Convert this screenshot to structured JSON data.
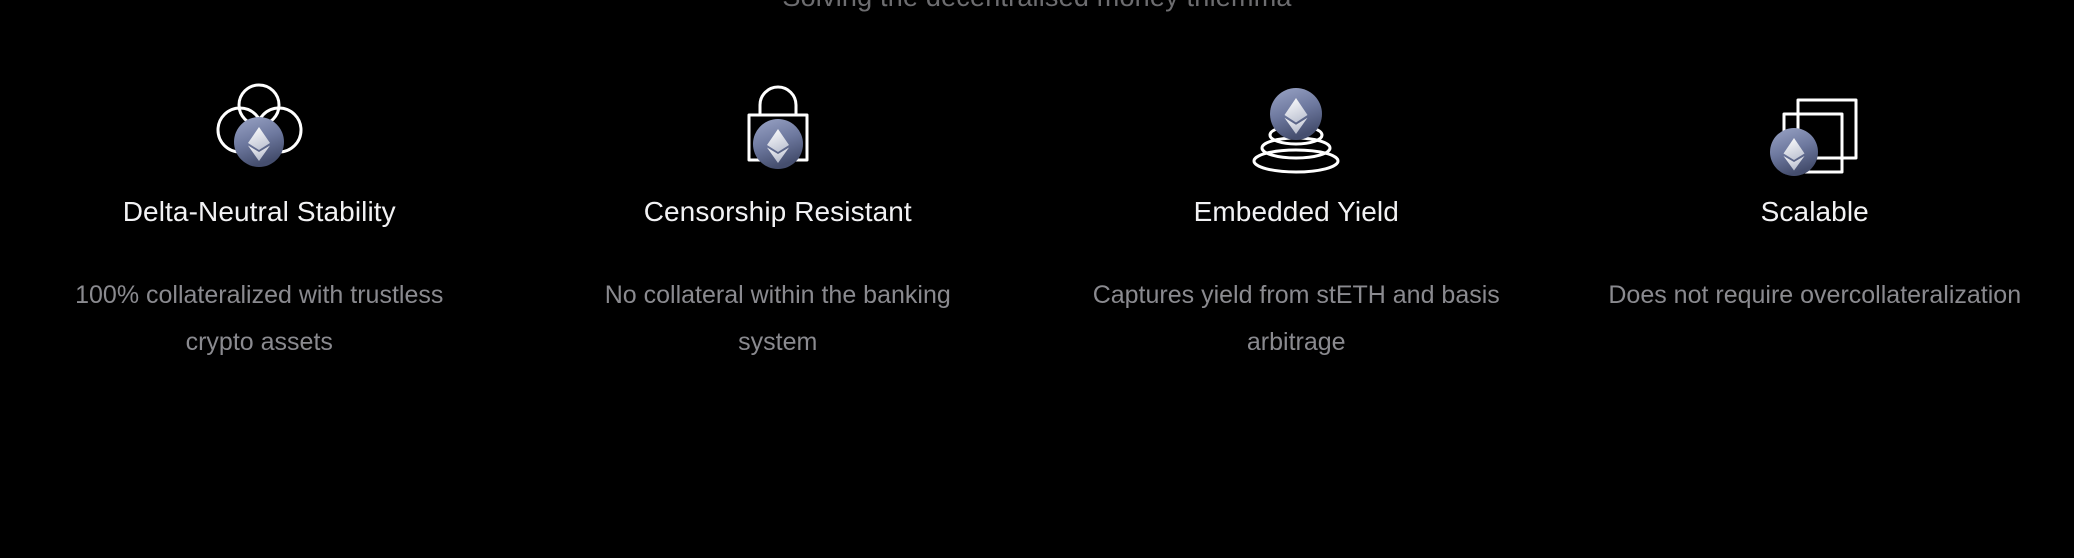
{
  "section": {
    "subtitle": "Solving the decentralised money trilemma"
  },
  "colors": {
    "background": "#000000",
    "title_text": "#f2f2f4",
    "body_text": "#8a8a8f",
    "subtitle_text": "#6d6d70",
    "badge_gradient_start": "#8e99bd",
    "badge_gradient_end": "#4e5878",
    "icon_stroke": "#ffffff"
  },
  "features": [
    {
      "icon": "cloud-three-circles-icon",
      "badge": "ethereum-badge-icon",
      "title": "Delta-Neutral Stability",
      "description": "100% collateralized with trustless crypto assets"
    },
    {
      "icon": "padlock-icon",
      "badge": "ethereum-badge-icon",
      "title": "Censorship Resistant",
      "description": "No collateral within the banking system"
    },
    {
      "icon": "stacked-layers-icon",
      "badge": "ethereum-badge-icon",
      "title": "Embedded Yield",
      "description": "Captures yield from stETH and basis arbitrage"
    },
    {
      "icon": "nested-squares-icon",
      "badge": "ethereum-badge-icon",
      "title": "Scalable",
      "description": "Does not require overcollateralization"
    }
  ]
}
